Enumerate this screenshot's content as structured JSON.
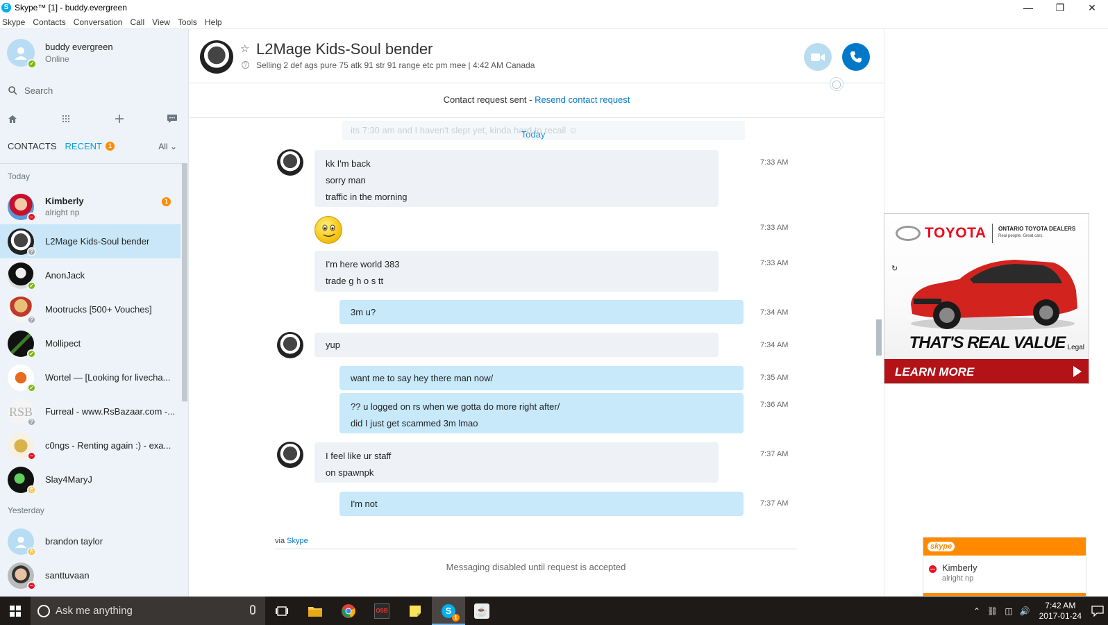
{
  "window": {
    "title": "Skype™ [1] - buddy.evergreen",
    "app_icon": "S"
  },
  "menu": [
    "Skype",
    "Contacts",
    "Conversation",
    "Call",
    "View",
    "Tools",
    "Help"
  ],
  "profile": {
    "name": "buddy evergreen",
    "status": "Online"
  },
  "search": {
    "placeholder": "Search"
  },
  "tabs": {
    "contacts": "CONTACTS",
    "recent": "RECENT",
    "recent_badge": "1",
    "filter": "All"
  },
  "sections": {
    "today": "Today",
    "yesterday": "Yesterday"
  },
  "contacts": [
    {
      "name": "Kimberly",
      "mood": "alright np",
      "status": "busy",
      "badge": "1",
      "bold": true
    },
    {
      "name": "L2Mage Kids-Soul bender",
      "mood": "",
      "status": "unknown",
      "active": true
    },
    {
      "name": "AnonJack",
      "mood": "",
      "status": "online"
    },
    {
      "name": "Mootrucks [500+ Vouches]",
      "mood": "",
      "status": "unknown"
    },
    {
      "name": "Mollipect",
      "mood": "",
      "status": "online"
    },
    {
      "name": "Wortel — [Looking for livecha...",
      "mood": "",
      "status": "online"
    },
    {
      "name": "Furreal - www.RsBazaar.com -...",
      "mood": "",
      "status": "unknown"
    },
    {
      "name": "c0ngs - Renting again :) - exa...",
      "mood": "",
      "status": "busy"
    },
    {
      "name": "Slay4MaryJ",
      "mood": "",
      "status": "away"
    },
    {
      "name": "brandon taylor",
      "mood": "",
      "status": "away"
    },
    {
      "name": "santtuvaan",
      "mood": "",
      "status": "busy"
    }
  ],
  "chat": {
    "title": "L2Mage Kids-Soul bender",
    "mood": "Selling 2 def ags pure 75 atk 91 str 91 range etc pm mee  |  4:42 AM Canada",
    "request_text": "Contact request sent - ",
    "request_link": "Resend contact request",
    "faded_message": "its 7:30 am and I haven't slept yet, kinda hard to recall ☺",
    "date_label": "Today",
    "messages": [
      {
        "lines": [
          "kk I'm back",
          "sorry man",
          "traffic in the morning"
        ],
        "time": "7:33 AM",
        "mine": false
      },
      {
        "lines": [],
        "emoji": "smile",
        "time": "7:33 AM",
        "mine": false
      },
      {
        "lines": [
          "I'm here world 383",
          "trade g h o s tt"
        ],
        "time": "7:33 AM",
        "mine": false
      },
      {
        "lines": [
          "3m u?"
        ],
        "time": "7:34 AM",
        "mine": true
      },
      {
        "lines": [
          "yup"
        ],
        "time": "7:34 AM",
        "mine": false
      },
      {
        "lines": [
          "want me to say hey there man now/"
        ],
        "time": "7:35 AM",
        "mine": true
      },
      {
        "lines": [
          "?? u logged on rs when we gotta do more right after/",
          "did I just get scammed 3m lmao"
        ],
        "time": "7:36 AM",
        "mine": true
      },
      {
        "lines": [
          "I feel like ur staff",
          "on spawnpk"
        ],
        "time": "7:37 AM",
        "mine": false
      },
      {
        "lines": [
          "I'm not"
        ],
        "time": "7:37 AM",
        "mine": true
      }
    ],
    "via_prefix": "via ",
    "via_link": "Skype",
    "disabled_note": "Messaging disabled until request is accepted"
  },
  "ad": {
    "brand": "TOYOTA",
    "dealers": "ONTARIO TOYOTA DEALERS",
    "tagline": "Real people. Great cars.",
    "slogan": "THAT'S REAL VALUE",
    "legal": "Legal",
    "cta": "LEARN MORE",
    "car_color": "#d2231f"
  },
  "notification": {
    "app": "skype",
    "name": "Kimberly",
    "message": "alright np"
  },
  "taskbar": {
    "search_placeholder": "Ask me anything",
    "time": "7:42 AM",
    "date": "2017-01-24",
    "apps": [
      "task-view",
      "file-explorer",
      "chrome",
      "osb",
      "sticky-notes",
      "skype",
      "java"
    ],
    "osb_label": "OSB",
    "skype_badge": "1"
  },
  "colors": {
    "accent": "#00aff0",
    "link": "#0078c9",
    "bubble_mine": "#c7e9fa",
    "bubble_theirs": "#eef2f6",
    "badge": "#ff8c00"
  }
}
